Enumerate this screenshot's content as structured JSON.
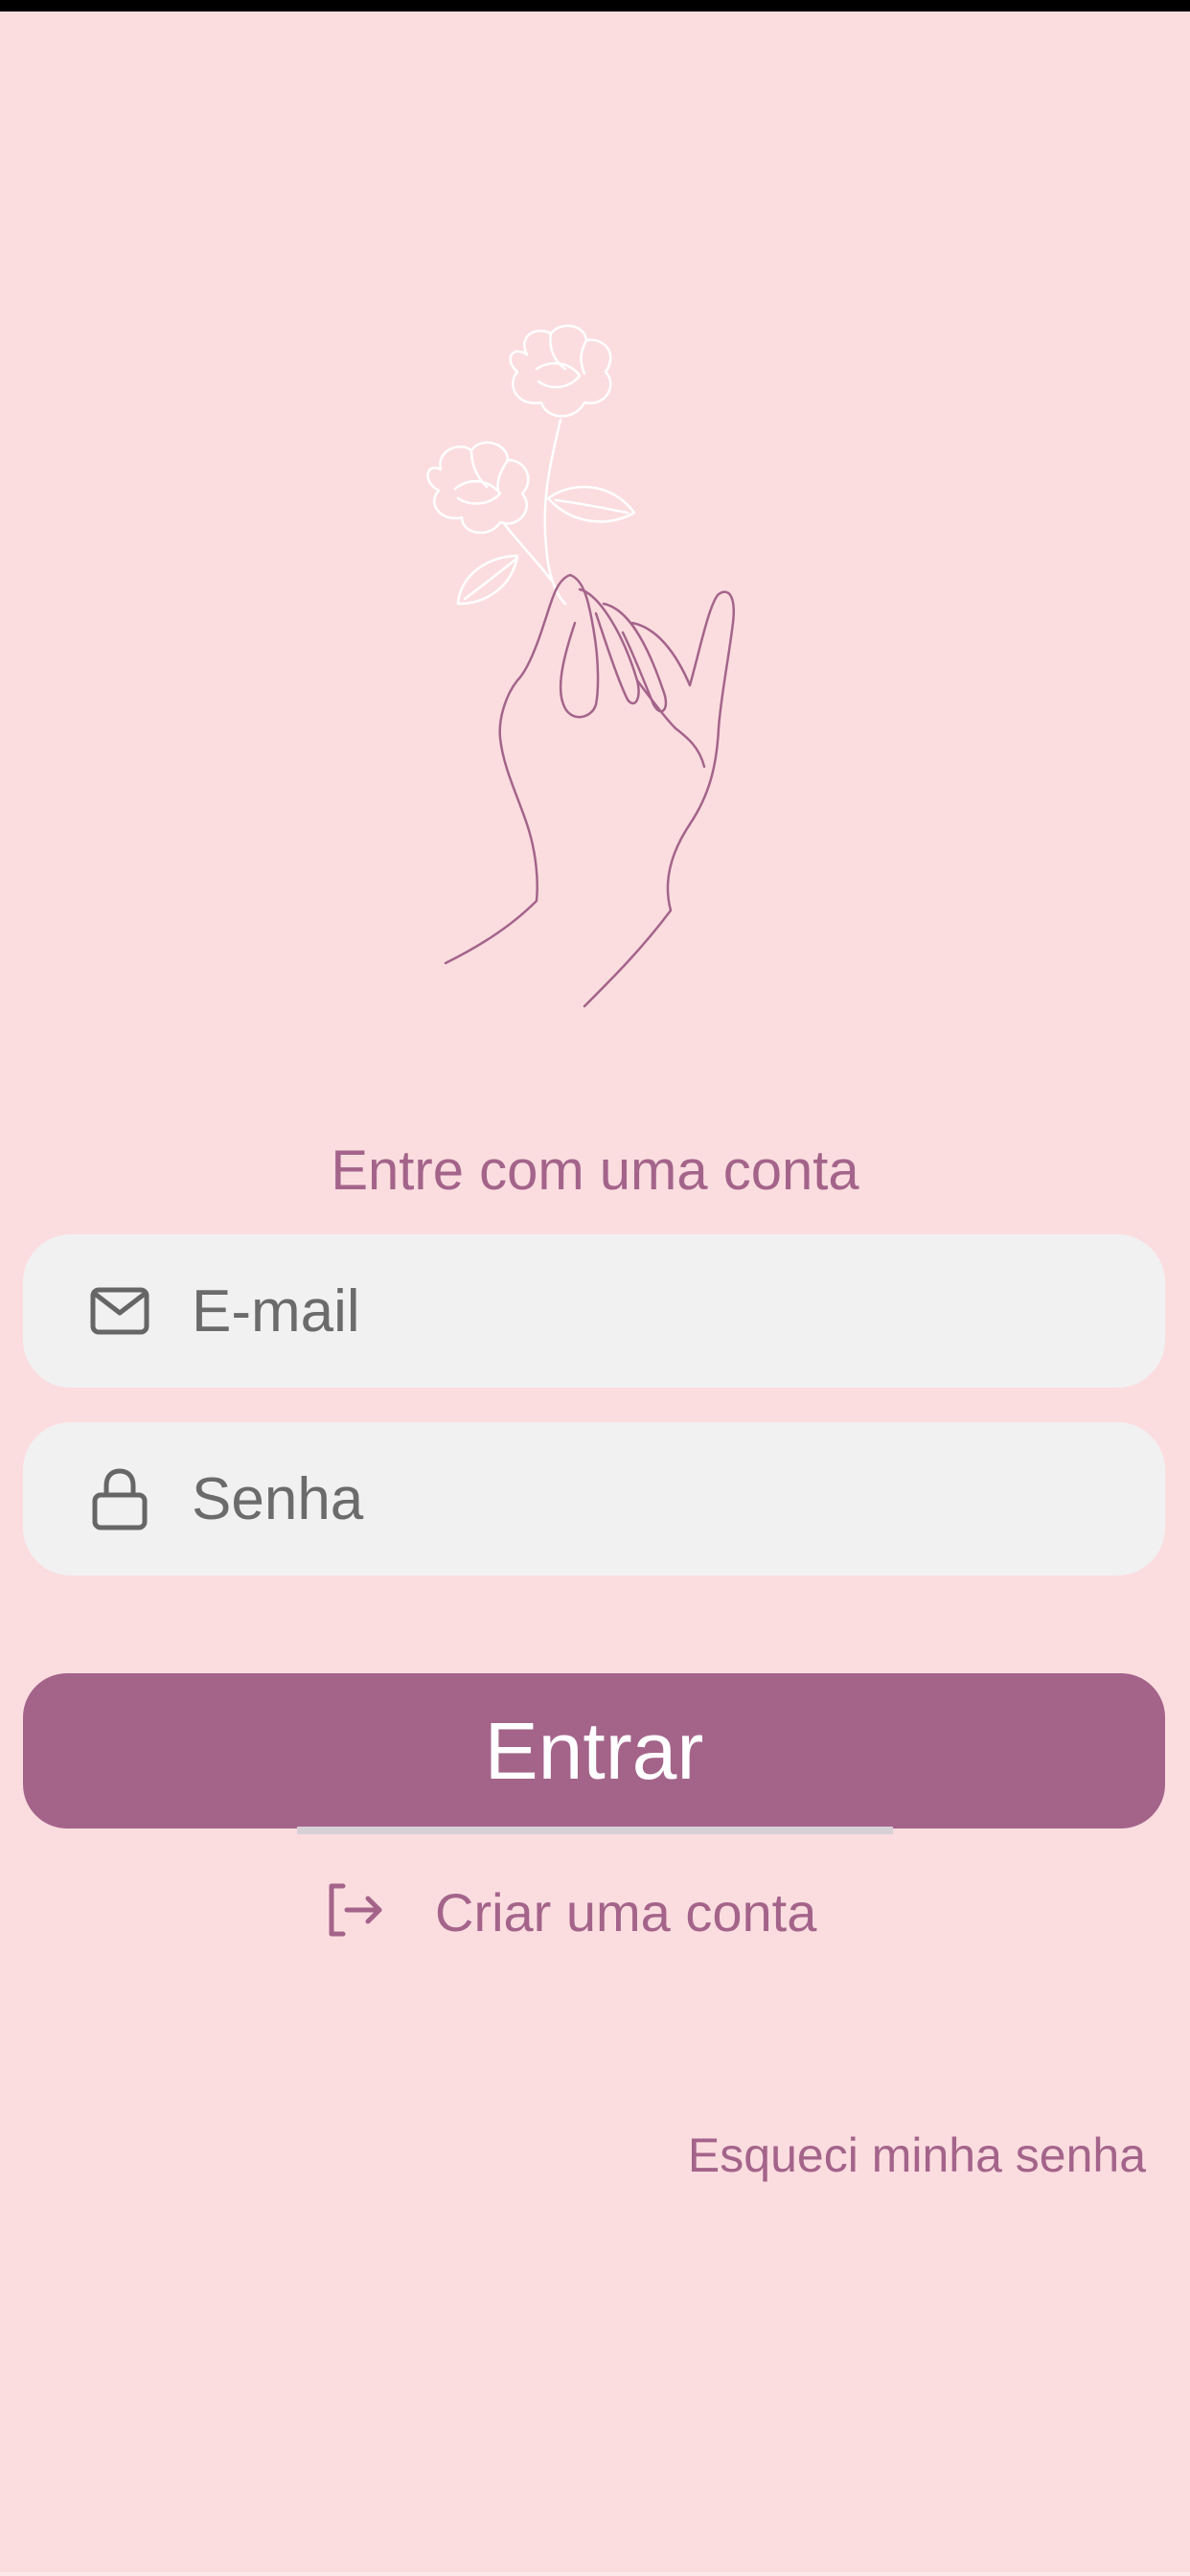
{
  "theme": {
    "background": "#fbdde0",
    "accent": "#a4648a",
    "field_bg": "#f1f1f2",
    "line_art_white": "#ffffff",
    "line_art_mauve": "#a4648a"
  },
  "illustration": {
    "icon": "hand-holding-flower-illustration"
  },
  "login": {
    "subtitle": "Entre com uma conta",
    "email": {
      "placeholder": "E-mail",
      "value": "",
      "icon": "mail-icon"
    },
    "password": {
      "placeholder": "Senha",
      "value": "",
      "icon": "lock-icon"
    },
    "submit_label": "Entrar",
    "create_account_label": "Criar uma conta",
    "create_account_icon": "sign-in-arrow-icon",
    "forgot_password_label": "Esqueci minha senha"
  }
}
